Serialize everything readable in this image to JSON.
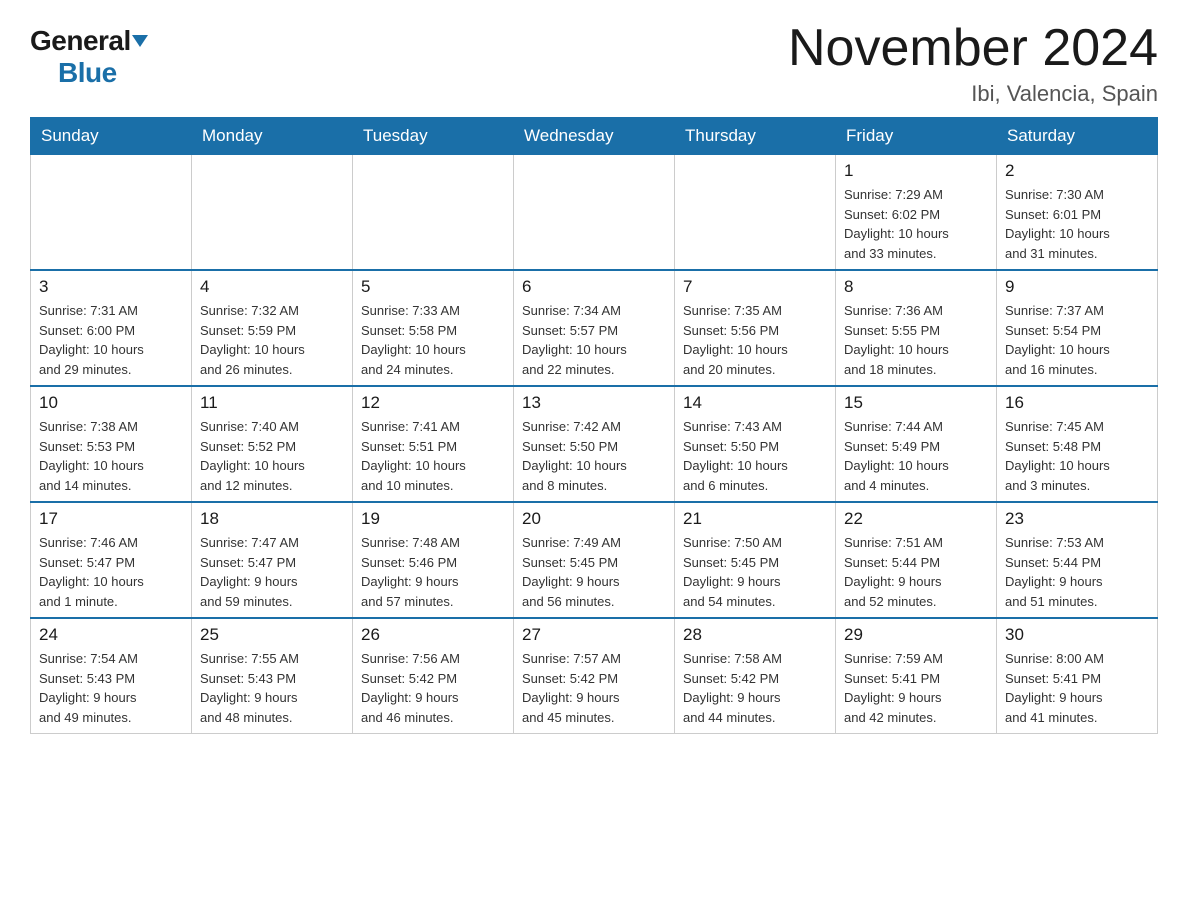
{
  "header": {
    "logo_general": "General",
    "logo_blue": "Blue",
    "main_title": "November 2024",
    "subtitle": "Ibi, Valencia, Spain"
  },
  "days_of_week": [
    "Sunday",
    "Monday",
    "Tuesday",
    "Wednesday",
    "Thursday",
    "Friday",
    "Saturday"
  ],
  "weeks": [
    {
      "days": [
        {
          "number": "",
          "info": ""
        },
        {
          "number": "",
          "info": ""
        },
        {
          "number": "",
          "info": ""
        },
        {
          "number": "",
          "info": ""
        },
        {
          "number": "",
          "info": ""
        },
        {
          "number": "1",
          "info": "Sunrise: 7:29 AM\nSunset: 6:02 PM\nDaylight: 10 hours\nand 33 minutes."
        },
        {
          "number": "2",
          "info": "Sunrise: 7:30 AM\nSunset: 6:01 PM\nDaylight: 10 hours\nand 31 minutes."
        }
      ]
    },
    {
      "days": [
        {
          "number": "3",
          "info": "Sunrise: 7:31 AM\nSunset: 6:00 PM\nDaylight: 10 hours\nand 29 minutes."
        },
        {
          "number": "4",
          "info": "Sunrise: 7:32 AM\nSunset: 5:59 PM\nDaylight: 10 hours\nand 26 minutes."
        },
        {
          "number": "5",
          "info": "Sunrise: 7:33 AM\nSunset: 5:58 PM\nDaylight: 10 hours\nand 24 minutes."
        },
        {
          "number": "6",
          "info": "Sunrise: 7:34 AM\nSunset: 5:57 PM\nDaylight: 10 hours\nand 22 minutes."
        },
        {
          "number": "7",
          "info": "Sunrise: 7:35 AM\nSunset: 5:56 PM\nDaylight: 10 hours\nand 20 minutes."
        },
        {
          "number": "8",
          "info": "Sunrise: 7:36 AM\nSunset: 5:55 PM\nDaylight: 10 hours\nand 18 minutes."
        },
        {
          "number": "9",
          "info": "Sunrise: 7:37 AM\nSunset: 5:54 PM\nDaylight: 10 hours\nand 16 minutes."
        }
      ]
    },
    {
      "days": [
        {
          "number": "10",
          "info": "Sunrise: 7:38 AM\nSunset: 5:53 PM\nDaylight: 10 hours\nand 14 minutes."
        },
        {
          "number": "11",
          "info": "Sunrise: 7:40 AM\nSunset: 5:52 PM\nDaylight: 10 hours\nand 12 minutes."
        },
        {
          "number": "12",
          "info": "Sunrise: 7:41 AM\nSunset: 5:51 PM\nDaylight: 10 hours\nand 10 minutes."
        },
        {
          "number": "13",
          "info": "Sunrise: 7:42 AM\nSunset: 5:50 PM\nDaylight: 10 hours\nand 8 minutes."
        },
        {
          "number": "14",
          "info": "Sunrise: 7:43 AM\nSunset: 5:50 PM\nDaylight: 10 hours\nand 6 minutes."
        },
        {
          "number": "15",
          "info": "Sunrise: 7:44 AM\nSunset: 5:49 PM\nDaylight: 10 hours\nand 4 minutes."
        },
        {
          "number": "16",
          "info": "Sunrise: 7:45 AM\nSunset: 5:48 PM\nDaylight: 10 hours\nand 3 minutes."
        }
      ]
    },
    {
      "days": [
        {
          "number": "17",
          "info": "Sunrise: 7:46 AM\nSunset: 5:47 PM\nDaylight: 10 hours\nand 1 minute."
        },
        {
          "number": "18",
          "info": "Sunrise: 7:47 AM\nSunset: 5:47 PM\nDaylight: 9 hours\nand 59 minutes."
        },
        {
          "number": "19",
          "info": "Sunrise: 7:48 AM\nSunset: 5:46 PM\nDaylight: 9 hours\nand 57 minutes."
        },
        {
          "number": "20",
          "info": "Sunrise: 7:49 AM\nSunset: 5:45 PM\nDaylight: 9 hours\nand 56 minutes."
        },
        {
          "number": "21",
          "info": "Sunrise: 7:50 AM\nSunset: 5:45 PM\nDaylight: 9 hours\nand 54 minutes."
        },
        {
          "number": "22",
          "info": "Sunrise: 7:51 AM\nSunset: 5:44 PM\nDaylight: 9 hours\nand 52 minutes."
        },
        {
          "number": "23",
          "info": "Sunrise: 7:53 AM\nSunset: 5:44 PM\nDaylight: 9 hours\nand 51 minutes."
        }
      ]
    },
    {
      "days": [
        {
          "number": "24",
          "info": "Sunrise: 7:54 AM\nSunset: 5:43 PM\nDaylight: 9 hours\nand 49 minutes."
        },
        {
          "number": "25",
          "info": "Sunrise: 7:55 AM\nSunset: 5:43 PM\nDaylight: 9 hours\nand 48 minutes."
        },
        {
          "number": "26",
          "info": "Sunrise: 7:56 AM\nSunset: 5:42 PM\nDaylight: 9 hours\nand 46 minutes."
        },
        {
          "number": "27",
          "info": "Sunrise: 7:57 AM\nSunset: 5:42 PM\nDaylight: 9 hours\nand 45 minutes."
        },
        {
          "number": "28",
          "info": "Sunrise: 7:58 AM\nSunset: 5:42 PM\nDaylight: 9 hours\nand 44 minutes."
        },
        {
          "number": "29",
          "info": "Sunrise: 7:59 AM\nSunset: 5:41 PM\nDaylight: 9 hours\nand 42 minutes."
        },
        {
          "number": "30",
          "info": "Sunrise: 8:00 AM\nSunset: 5:41 PM\nDaylight: 9 hours\nand 41 minutes."
        }
      ]
    }
  ]
}
